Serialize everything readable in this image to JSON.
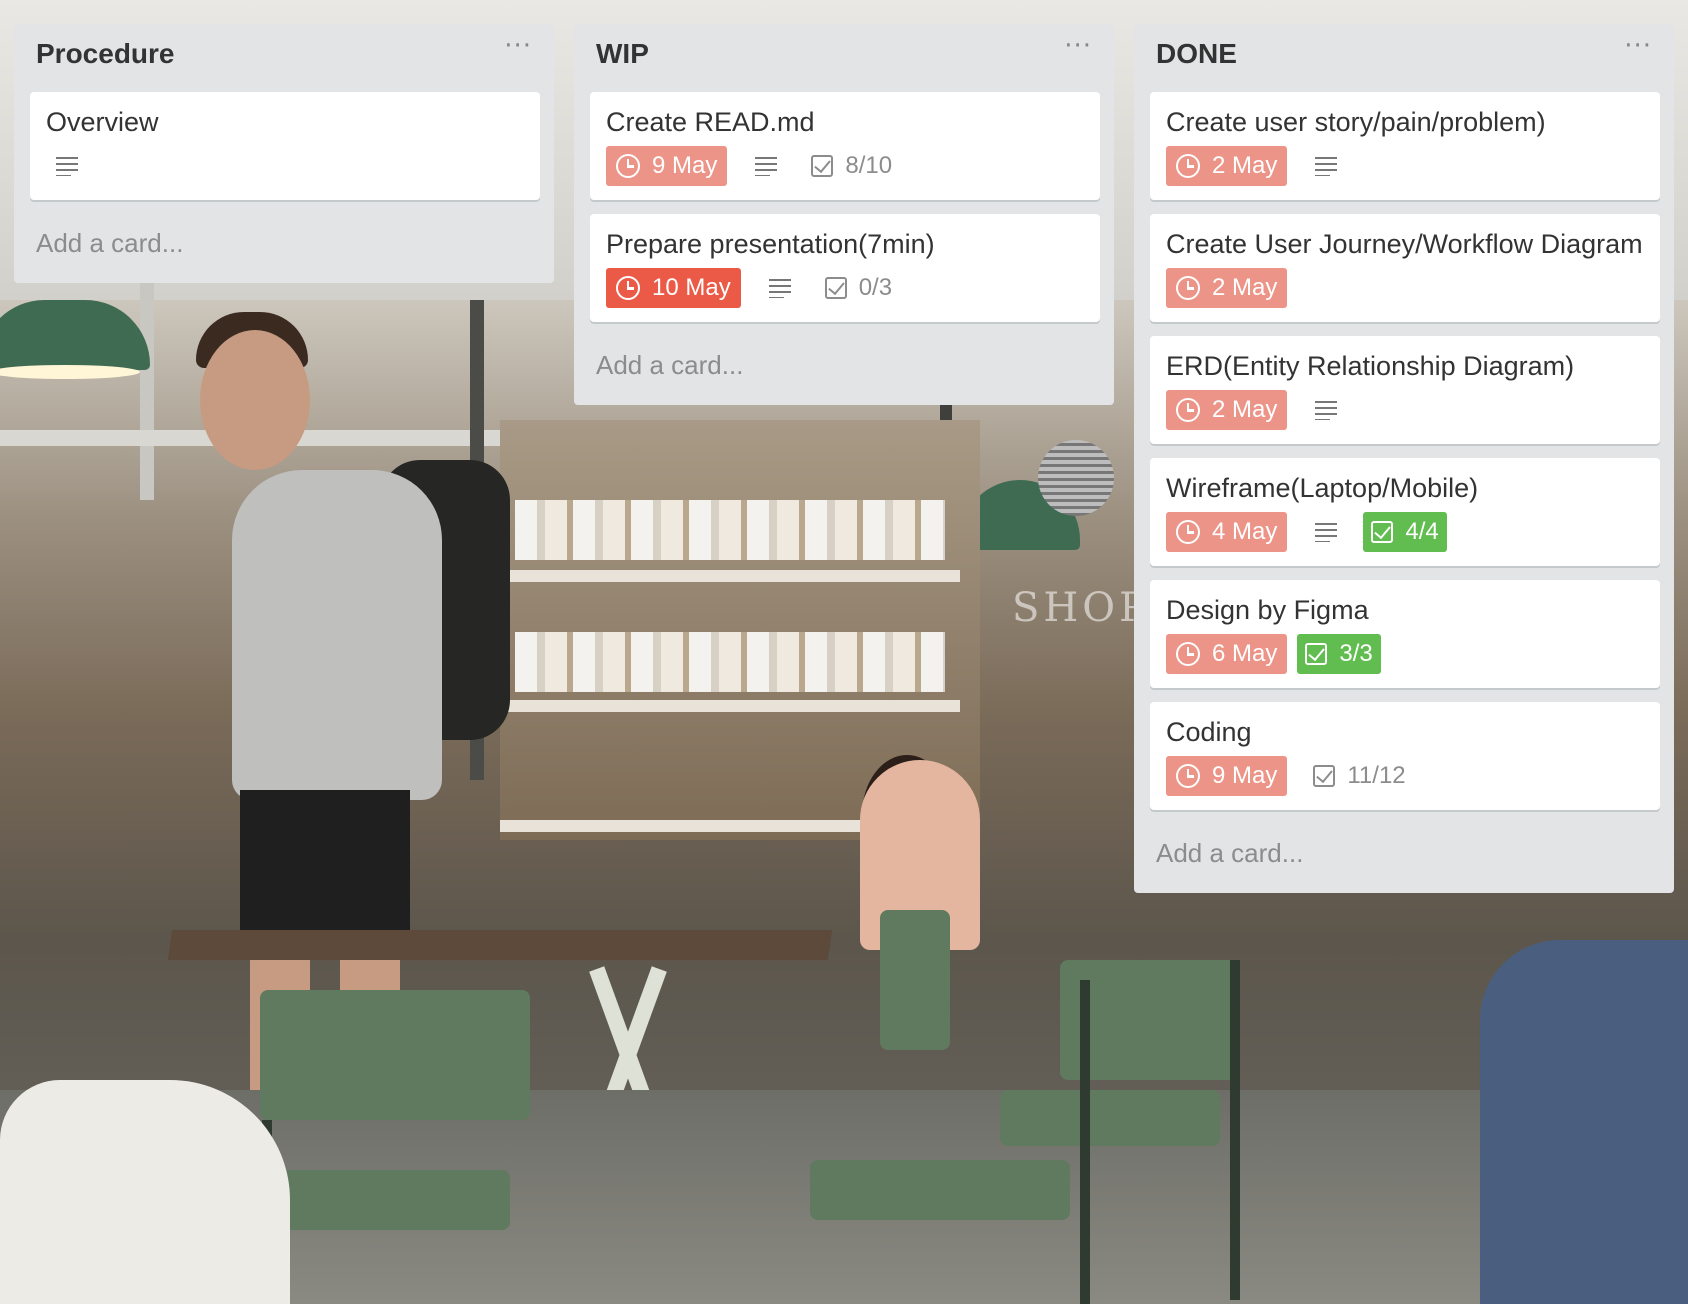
{
  "icons": {
    "due": "clock-icon",
    "description": "description-icon",
    "checklist": "checklist-icon",
    "menu": "ellipsis-icon"
  },
  "colors": {
    "list_bg": "#e2e4e6",
    "due_soon": "#ec9488",
    "due_overdue": "#eb5a46",
    "checklist_complete": "#61bd4f"
  },
  "background": {
    "sign_text": "SHOP"
  },
  "lists": [
    {
      "title": "Procedure",
      "menu_label": "···",
      "add_label": "Add a card...",
      "cards": [
        {
          "title": "Overview",
          "description": true
        }
      ]
    },
    {
      "title": "WIP",
      "menu_label": "···",
      "add_label": "Add a card...",
      "cards": [
        {
          "title": "Create READ.md",
          "due": "9 May",
          "due_state": "soon",
          "description": true,
          "checklist": "8/10",
          "checklist_complete": false
        },
        {
          "title": "Prepare presentation(7min)",
          "due": "10 May",
          "due_state": "overdue",
          "description": true,
          "checklist": "0/3",
          "checklist_complete": false
        }
      ]
    },
    {
      "title": "DONE",
      "menu_label": "···",
      "add_label": "Add a card...",
      "cards": [
        {
          "title": "Create user story/pain/problem)",
          "due": "2 May",
          "due_state": "soon",
          "description": true
        },
        {
          "title": "Create User Journey/Workflow Diagram",
          "due": "2 May",
          "due_state": "soon",
          "description": false
        },
        {
          "title": "ERD(Entity Relationship Diagram)",
          "due": "2 May",
          "due_state": "soon",
          "description": true
        },
        {
          "title": "Wireframe(Laptop/Mobile)",
          "due": "4 May",
          "due_state": "soon",
          "description": true,
          "checklist": "4/4",
          "checklist_complete": true
        },
        {
          "title": "Design by Figma",
          "due": "6 May",
          "due_state": "soon",
          "description": false,
          "checklist": "3/3",
          "checklist_complete": true
        },
        {
          "title": "Coding",
          "due": "9 May",
          "due_state": "soon",
          "description": false,
          "checklist": "11/12",
          "checklist_complete": false
        }
      ]
    }
  ]
}
